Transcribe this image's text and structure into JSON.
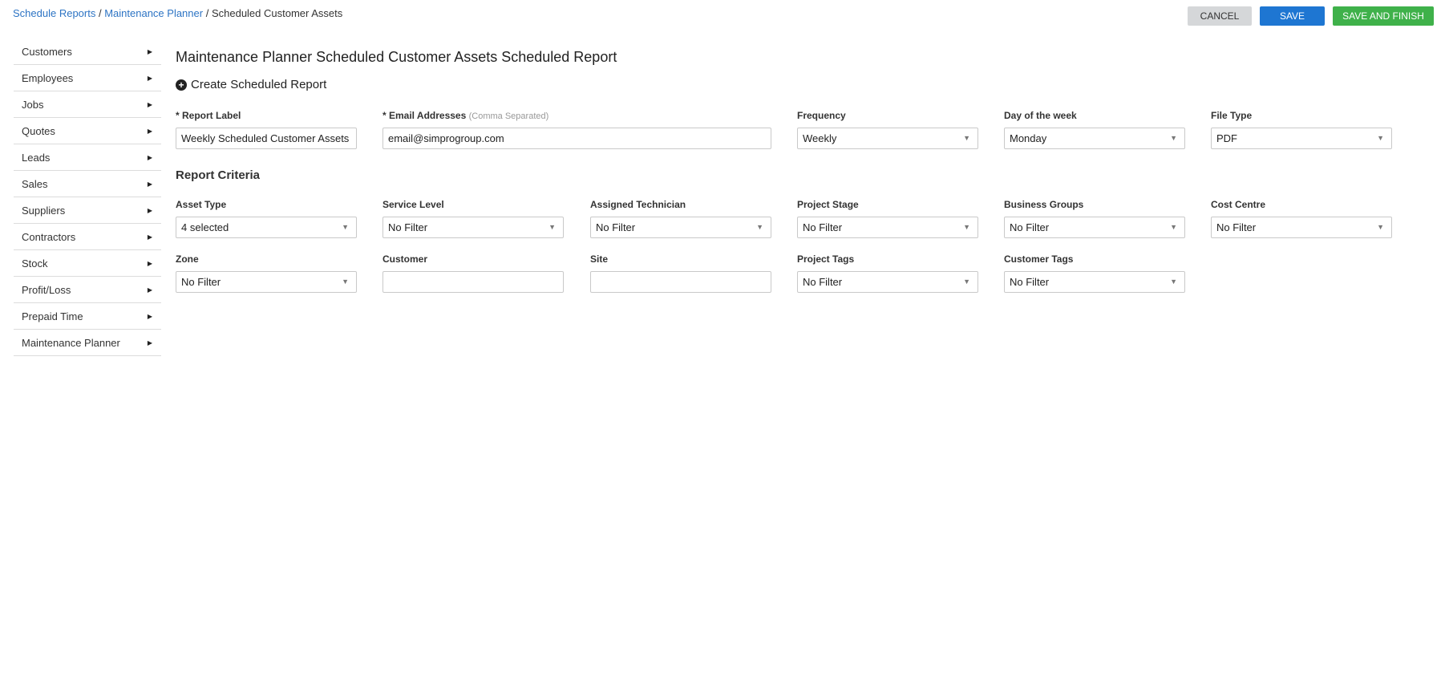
{
  "breadcrumb": {
    "items": [
      {
        "label": "Schedule Reports",
        "link": true
      },
      {
        "label": "Maintenance Planner",
        "link": true
      },
      {
        "label": "Scheduled Customer Assets",
        "link": false
      }
    ],
    "separator": "/"
  },
  "actions": {
    "cancel_label": "CANCEL",
    "save_label": "SAVE",
    "save_finish_label": "SAVE AND FINISH"
  },
  "sidebar": {
    "caret": "▶",
    "items": [
      {
        "label": "Customers"
      },
      {
        "label": "Employees"
      },
      {
        "label": "Jobs"
      },
      {
        "label": "Quotes"
      },
      {
        "label": "Leads"
      },
      {
        "label": "Sales"
      },
      {
        "label": "Suppliers"
      },
      {
        "label": "Contractors"
      },
      {
        "label": "Stock"
      },
      {
        "label": "Profit/Loss"
      },
      {
        "label": "Prepaid Time"
      },
      {
        "label": "Maintenance Planner"
      }
    ]
  },
  "main": {
    "title": "Maintenance Planner Scheduled Customer Assets Scheduled Report",
    "create_label": "Create Scheduled Report",
    "form": {
      "report_label": {
        "label": "* Report Label",
        "value": "Weekly Scheduled Customer Assets"
      },
      "email": {
        "label": "* Email Addresses",
        "hint": "(Comma Separated)",
        "value": "email@simprogroup.com"
      },
      "frequency": {
        "label": "Frequency",
        "value": "Weekly"
      },
      "day_of_week": {
        "label": "Day of the week",
        "value": "Monday"
      },
      "file_type": {
        "label": "File Type",
        "value": "PDF"
      }
    },
    "criteria_title": "Report Criteria",
    "criteria": {
      "asset_type": {
        "label": "Asset Type",
        "value": "4 selected"
      },
      "service_level": {
        "label": "Service Level",
        "value": "No Filter"
      },
      "assigned_technician": {
        "label": "Assigned Technician",
        "value": "No Filter"
      },
      "project_stage": {
        "label": "Project Stage",
        "value": "No Filter"
      },
      "business_groups": {
        "label": "Business Groups",
        "value": "No Filter"
      },
      "cost_centre": {
        "label": "Cost Centre",
        "value": "No Filter"
      },
      "zone": {
        "label": "Zone",
        "value": "No Filter"
      },
      "customer": {
        "label": "Customer",
        "value": ""
      },
      "site": {
        "label": "Site",
        "value": ""
      },
      "project_tags": {
        "label": "Project Tags",
        "value": "No Filter"
      },
      "customer_tags": {
        "label": "Customer Tags",
        "value": "No Filter"
      }
    },
    "dropdown_arrow": "▼"
  }
}
